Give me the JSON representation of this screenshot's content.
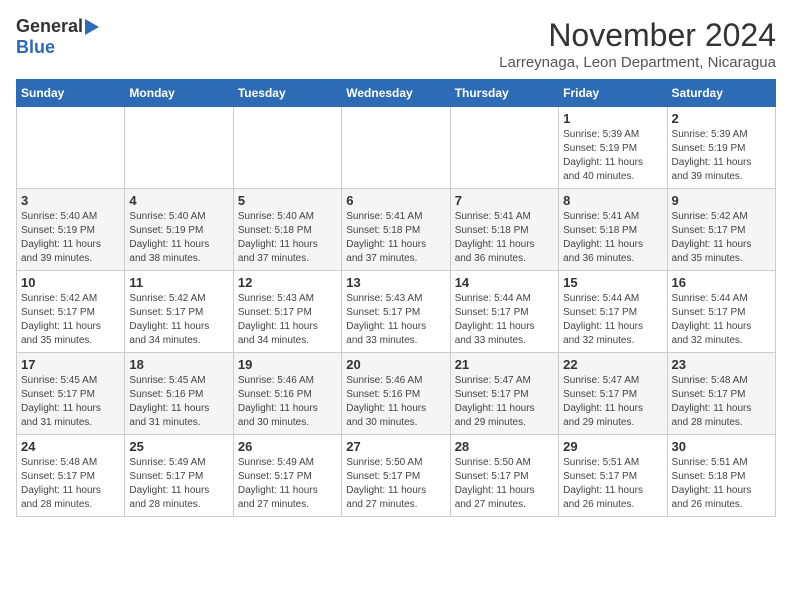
{
  "header": {
    "logo_general": "General",
    "logo_blue": "Blue",
    "month_title": "November 2024",
    "location": "Larreynaga, Leon Department, Nicaragua"
  },
  "weekdays": [
    "Sunday",
    "Monday",
    "Tuesday",
    "Wednesday",
    "Thursday",
    "Friday",
    "Saturday"
  ],
  "weeks": [
    [
      {
        "day": "",
        "info": ""
      },
      {
        "day": "",
        "info": ""
      },
      {
        "day": "",
        "info": ""
      },
      {
        "day": "",
        "info": ""
      },
      {
        "day": "",
        "info": ""
      },
      {
        "day": "1",
        "info": "Sunrise: 5:39 AM\nSunset: 5:19 PM\nDaylight: 11 hours\nand 40 minutes."
      },
      {
        "day": "2",
        "info": "Sunrise: 5:39 AM\nSunset: 5:19 PM\nDaylight: 11 hours\nand 39 minutes."
      }
    ],
    [
      {
        "day": "3",
        "info": "Sunrise: 5:40 AM\nSunset: 5:19 PM\nDaylight: 11 hours\nand 39 minutes."
      },
      {
        "day": "4",
        "info": "Sunrise: 5:40 AM\nSunset: 5:19 PM\nDaylight: 11 hours\nand 38 minutes."
      },
      {
        "day": "5",
        "info": "Sunrise: 5:40 AM\nSunset: 5:18 PM\nDaylight: 11 hours\nand 37 minutes."
      },
      {
        "day": "6",
        "info": "Sunrise: 5:41 AM\nSunset: 5:18 PM\nDaylight: 11 hours\nand 37 minutes."
      },
      {
        "day": "7",
        "info": "Sunrise: 5:41 AM\nSunset: 5:18 PM\nDaylight: 11 hours\nand 36 minutes."
      },
      {
        "day": "8",
        "info": "Sunrise: 5:41 AM\nSunset: 5:18 PM\nDaylight: 11 hours\nand 36 minutes."
      },
      {
        "day": "9",
        "info": "Sunrise: 5:42 AM\nSunset: 5:17 PM\nDaylight: 11 hours\nand 35 minutes."
      }
    ],
    [
      {
        "day": "10",
        "info": "Sunrise: 5:42 AM\nSunset: 5:17 PM\nDaylight: 11 hours\nand 35 minutes."
      },
      {
        "day": "11",
        "info": "Sunrise: 5:42 AM\nSunset: 5:17 PM\nDaylight: 11 hours\nand 34 minutes."
      },
      {
        "day": "12",
        "info": "Sunrise: 5:43 AM\nSunset: 5:17 PM\nDaylight: 11 hours\nand 34 minutes."
      },
      {
        "day": "13",
        "info": "Sunrise: 5:43 AM\nSunset: 5:17 PM\nDaylight: 11 hours\nand 33 minutes."
      },
      {
        "day": "14",
        "info": "Sunrise: 5:44 AM\nSunset: 5:17 PM\nDaylight: 11 hours\nand 33 minutes."
      },
      {
        "day": "15",
        "info": "Sunrise: 5:44 AM\nSunset: 5:17 PM\nDaylight: 11 hours\nand 32 minutes."
      },
      {
        "day": "16",
        "info": "Sunrise: 5:44 AM\nSunset: 5:17 PM\nDaylight: 11 hours\nand 32 minutes."
      }
    ],
    [
      {
        "day": "17",
        "info": "Sunrise: 5:45 AM\nSunset: 5:17 PM\nDaylight: 11 hours\nand 31 minutes."
      },
      {
        "day": "18",
        "info": "Sunrise: 5:45 AM\nSunset: 5:16 PM\nDaylight: 11 hours\nand 31 minutes."
      },
      {
        "day": "19",
        "info": "Sunrise: 5:46 AM\nSunset: 5:16 PM\nDaylight: 11 hours\nand 30 minutes."
      },
      {
        "day": "20",
        "info": "Sunrise: 5:46 AM\nSunset: 5:16 PM\nDaylight: 11 hours\nand 30 minutes."
      },
      {
        "day": "21",
        "info": "Sunrise: 5:47 AM\nSunset: 5:17 PM\nDaylight: 11 hours\nand 29 minutes."
      },
      {
        "day": "22",
        "info": "Sunrise: 5:47 AM\nSunset: 5:17 PM\nDaylight: 11 hours\nand 29 minutes."
      },
      {
        "day": "23",
        "info": "Sunrise: 5:48 AM\nSunset: 5:17 PM\nDaylight: 11 hours\nand 28 minutes."
      }
    ],
    [
      {
        "day": "24",
        "info": "Sunrise: 5:48 AM\nSunset: 5:17 PM\nDaylight: 11 hours\nand 28 minutes."
      },
      {
        "day": "25",
        "info": "Sunrise: 5:49 AM\nSunset: 5:17 PM\nDaylight: 11 hours\nand 28 minutes."
      },
      {
        "day": "26",
        "info": "Sunrise: 5:49 AM\nSunset: 5:17 PM\nDaylight: 11 hours\nand 27 minutes."
      },
      {
        "day": "27",
        "info": "Sunrise: 5:50 AM\nSunset: 5:17 PM\nDaylight: 11 hours\nand 27 minutes."
      },
      {
        "day": "28",
        "info": "Sunrise: 5:50 AM\nSunset: 5:17 PM\nDaylight: 11 hours\nand 27 minutes."
      },
      {
        "day": "29",
        "info": "Sunrise: 5:51 AM\nSunset: 5:17 PM\nDaylight: 11 hours\nand 26 minutes."
      },
      {
        "day": "30",
        "info": "Sunrise: 5:51 AM\nSunset: 5:18 PM\nDaylight: 11 hours\nand 26 minutes."
      }
    ]
  ]
}
